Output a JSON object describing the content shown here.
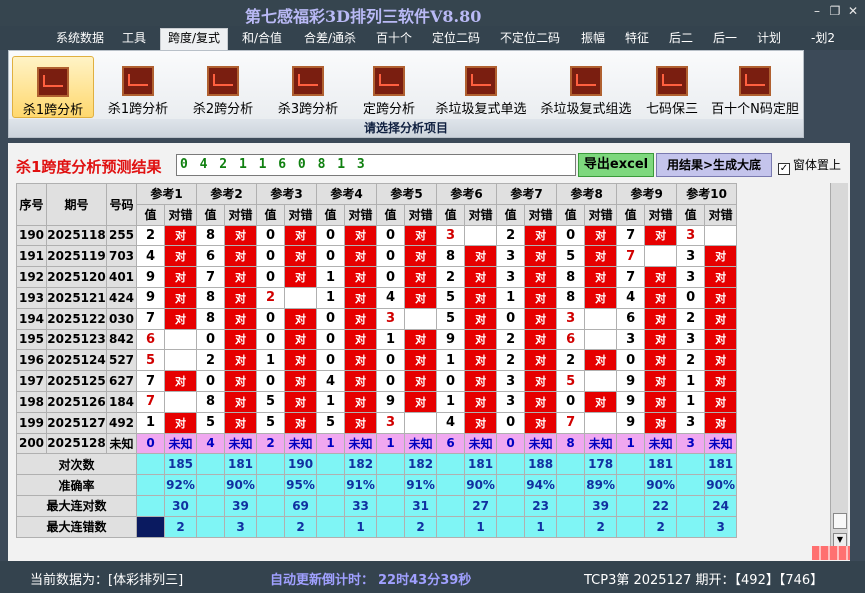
{
  "app": {
    "title": "第七感福彩3D排列三软件V8.80"
  },
  "menu": [
    "系统数据",
    "工具",
    "跨度/复式",
    "和/合值",
    "合差/通杀",
    "百十个",
    "定位二码",
    "不定位二码",
    "振幅",
    "特征",
    "后二",
    "后一",
    "计划",
    "-划2"
  ],
  "ribbon": {
    "buttons": [
      "杀1跨分析",
      "杀1跨分析",
      "杀2跨分析",
      "杀3跨分析",
      "定跨分析",
      "杀垃圾复式单选",
      "杀垃圾复式组选",
      "七码保三",
      "百十个N码定胆"
    ],
    "footer": "请选择分析项目"
  },
  "result": {
    "title": "杀1跨度分析预测结果",
    "value": "0 4 2 1 1 6 0 8 1 3",
    "excel_btn": "导出excel",
    "gen_btn": "用结果>生成大底",
    "topmost_label": "窗体置上",
    "topmost_check": "✓"
  },
  "table": {
    "headers": {
      "seq": "序号",
      "period": "期号",
      "code": "号码",
      "val": "值",
      "ok": "对错"
    },
    "refs": [
      "参考1",
      "参考2",
      "参考3",
      "参考4",
      "参考5",
      "参考6",
      "参考7",
      "参考8",
      "参考9",
      "参考10"
    ],
    "ok_text": "对",
    "rows": [
      {
        "seq": "190",
        "period": "2025118",
        "code": "255",
        "vals": [
          "2",
          "8",
          "0",
          "0",
          "0",
          "3",
          "2",
          "0",
          "7",
          "3"
        ],
        "hit": [
          1,
          1,
          1,
          1,
          1,
          0,
          1,
          1,
          1,
          0
        ]
      },
      {
        "seq": "191",
        "period": "2025119",
        "code": "703",
        "vals": [
          "4",
          "6",
          "0",
          "0",
          "0",
          "8",
          "3",
          "5",
          "7",
          "3"
        ],
        "hit": [
          1,
          1,
          1,
          1,
          1,
          1,
          1,
          1,
          0,
          1
        ]
      },
      {
        "seq": "192",
        "period": "2025120",
        "code": "401",
        "vals": [
          "9",
          "7",
          "0",
          "1",
          "0",
          "2",
          "3",
          "8",
          "7",
          "3"
        ],
        "hit": [
          1,
          1,
          1,
          1,
          1,
          1,
          1,
          1,
          1,
          1
        ]
      },
      {
        "seq": "193",
        "period": "2025121",
        "code": "424",
        "vals": [
          "9",
          "8",
          "2",
          "1",
          "4",
          "5",
          "1",
          "8",
          "4",
          "0"
        ],
        "hit": [
          1,
          1,
          0,
          1,
          1,
          1,
          1,
          1,
          1,
          1
        ]
      },
      {
        "seq": "194",
        "period": "2025122",
        "code": "030",
        "vals": [
          "7",
          "8",
          "0",
          "0",
          "3",
          "5",
          "0",
          "3",
          "6",
          "2"
        ],
        "hit": [
          1,
          1,
          1,
          1,
          0,
          1,
          1,
          0,
          1,
          1
        ]
      },
      {
        "seq": "195",
        "period": "2025123",
        "code": "842",
        "vals": [
          "6",
          "0",
          "0",
          "0",
          "1",
          "9",
          "2",
          "6",
          "3",
          "3"
        ],
        "hit": [
          0,
          1,
          1,
          1,
          1,
          1,
          1,
          0,
          1,
          1
        ]
      },
      {
        "seq": "196",
        "period": "2025124",
        "code": "527",
        "vals": [
          "5",
          "2",
          "1",
          "0",
          "0",
          "1",
          "2",
          "2",
          "0",
          "2"
        ],
        "hit": [
          0,
          1,
          1,
          1,
          1,
          1,
          1,
          1,
          1,
          1
        ]
      },
      {
        "seq": "197",
        "period": "2025125",
        "code": "627",
        "vals": [
          "7",
          "0",
          "0",
          "4",
          "0",
          "0",
          "3",
          "5",
          "9",
          "1"
        ],
        "hit": [
          1,
          1,
          1,
          1,
          1,
          1,
          1,
          0,
          1,
          1
        ]
      },
      {
        "seq": "198",
        "period": "2025126",
        "code": "184",
        "vals": [
          "7",
          "8",
          "5",
          "1",
          "9",
          "1",
          "3",
          "0",
          "9",
          "1"
        ],
        "hit": [
          0,
          1,
          1,
          1,
          1,
          1,
          1,
          1,
          1,
          1
        ]
      },
      {
        "seq": "199",
        "period": "2025127",
        "code": "492",
        "vals": [
          "1",
          "5",
          "5",
          "5",
          "3",
          "4",
          "0",
          "7",
          "9",
          "3"
        ],
        "hit": [
          1,
          1,
          1,
          1,
          0,
          1,
          1,
          0,
          1,
          1
        ]
      }
    ],
    "pending": {
      "seq": "200",
      "period": "2025128",
      "code": "未知",
      "vals": [
        "0",
        "4",
        "2",
        "1",
        "1",
        "6",
        "0",
        "8",
        "1",
        "3"
      ],
      "status": "未知"
    },
    "stats": [
      {
        "label": "对次数",
        "vals": [
          "185",
          "181",
          "190",
          "182",
          "182",
          "181",
          "188",
          "178",
          "181",
          "181"
        ]
      },
      {
        "label": "准确率",
        "vals": [
          "92%",
          "90%",
          "95%",
          "91%",
          "91%",
          "90%",
          "94%",
          "89%",
          "90%",
          "90%"
        ]
      },
      {
        "label": "最大连对数",
        "vals": [
          "30",
          "39",
          "69",
          "33",
          "31",
          "27",
          "23",
          "39",
          "22",
          "24"
        ]
      },
      {
        "label": "最大连错数",
        "vals": [
          "2",
          "3",
          "2",
          "1",
          "2",
          "1",
          "1",
          "2",
          "2",
          "3"
        ]
      }
    ]
  },
  "status": {
    "source": "当前数据为：[体彩排列三]",
    "countdown_label": "自动更新倒计时：",
    "countdown": "22时43分39秒",
    "draw": "TCP3第 2025127 期开：【492】【746】"
  },
  "colors": {
    "hit": "#e60000",
    "pending": "#f0a8f0",
    "stats": "#7ff5f5"
  }
}
